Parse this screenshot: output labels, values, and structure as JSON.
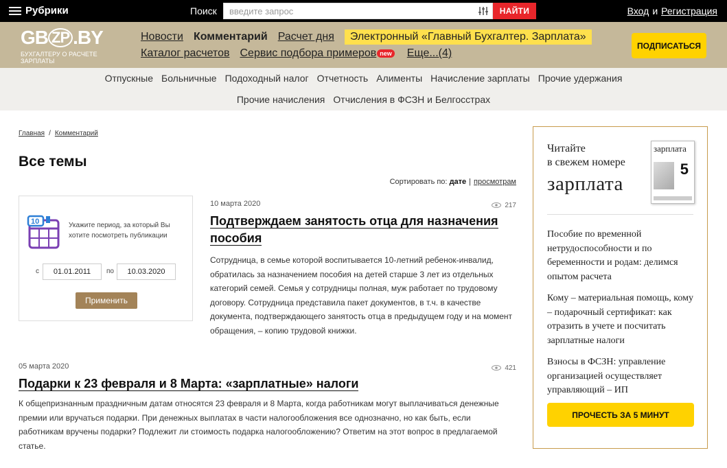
{
  "topbar": {
    "menu_label": "Рубрики",
    "search_label": "Поиск",
    "search_placeholder": "введите запрос",
    "search_button": "НАЙТИ",
    "login": "Вход",
    "and": "и",
    "register": "Регистрация"
  },
  "brand": {
    "logo_left": "GB",
    "logo_zp": "ZP",
    "logo_right": ".BY",
    "logo_tagline": "БУХГАЛТЕРУ О РАСЧЕТЕ ЗАРПЛАТЫ",
    "nav_row1": [
      "Новости",
      "Комментарий",
      "Расчет дня"
    ],
    "nav_highlight": "Электронный «Главный Бухгалтер. Зарплата»",
    "nav_row2": [
      "Каталог расчетов",
      "Сервис подбора примеров",
      "Еще...(4)"
    ],
    "new_badge": "new",
    "subscribe": "ПОДПИСАТЬСЯ"
  },
  "categories": {
    "row1": [
      "Отпускные",
      "Больничные",
      "Подоходный налог",
      "Отчетность",
      "Алименты",
      "Начисление зарплаты",
      "Прочие удержания"
    ],
    "row2": [
      "Прочие начисления",
      "Отчисления в ФСЗН и Белгосстрах"
    ]
  },
  "breadcrumb": {
    "home": "Главная",
    "current": "Комментарий",
    "sep": "/"
  },
  "page_title": "Все темы",
  "sort": {
    "label": "Сортировать по:",
    "active": "дате",
    "bar": "|",
    "other": "просмотрам"
  },
  "period": {
    "hint": "Укажите период, за который Вы хотите посмотреть публикации",
    "from_label": "с",
    "from_value": "01.01.2011",
    "to_label": "по",
    "to_value": "10.03.2020",
    "apply": "Применить"
  },
  "articles": [
    {
      "date": "10 марта 2020",
      "views": "217",
      "title": "Подтверждаем занятость отца для назначения пособия",
      "text": "Сотрудница, в семье которой воспитывается 10-летний ребенок-инвалид, обратилась за назначением пособия на детей старше 3 лет из отдельных категорий семей. Семья у сотрудницы полная, муж работает по трудовому договору. Сотрудница представила пакет документов, в т.ч. в качестве документа, подтверждающего занятость отца в предыдущем году и на момент обращения, – копию трудовой книжки."
    },
    {
      "date": "05 марта 2020",
      "views": "421",
      "title": "Подарки к 23 февраля и 8 Марта: «зарплатные» налоги",
      "text": "К общепризнанным праздничным датам относятся 23 февраля и 8 Марта, когда работникам могут выплачиваться денежные премии или вручаться подарки. При денежных выплатах в части налогообложения все однозначно, но как быть, если работникам вручены подарки? Подлежит ли стоимость подарка налогообложению? Ответим на этот вопрос в предлагаемой статье."
    }
  ],
  "sidebar": {
    "promo_line1": "Читайте",
    "promo_line2": "в свежем номере",
    "promo_logo": "зарплата",
    "mag_title": "зарплата",
    "mag_number": "5",
    "links": [
      "Пособие по временной нетрудоспособности и по беременности и родам: делимся опытом расчета",
      "Кому – материальная помощь, кому – подарочный сертификат: как отразить в учете и посчитать зарплатные налоги",
      "Взносы в ФСЗН: управление организацией осуществляет управляющий – ИП"
    ],
    "read_button": "ПРОЧЕСТЬ ЗА 5 МИНУТ"
  }
}
